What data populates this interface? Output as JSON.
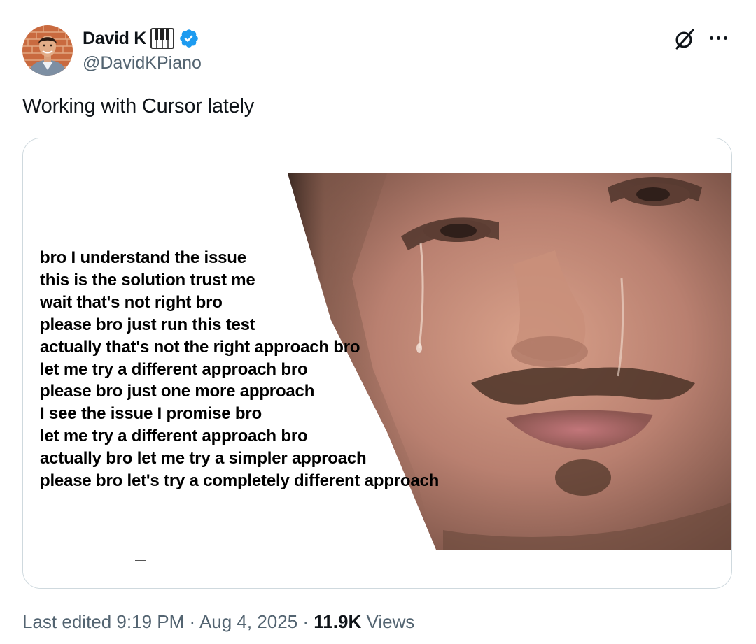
{
  "author": {
    "display_name": "David K",
    "emoji_icon": "piano-keys-icon",
    "verified_icon": "verified-badge-icon",
    "handle": "@DavidKPiano",
    "avatar_icon": "avatar"
  },
  "actions": {
    "grok_icon": "grok-icon",
    "more_icon": "more-icon"
  },
  "tweet": {
    "text": "Working with Cursor lately"
  },
  "meme": {
    "lines": [
      "bro I understand the issue",
      "this is the solution trust me",
      "wait that's not right bro",
      "please bro just run this test",
      "actually that's not the right approach bro",
      "let me try a different approach bro",
      "please bro just one more approach",
      "I see the issue I promise bro",
      "let me try a different approach bro",
      "actually bro let me try a simpler approach",
      "please bro let's try a completely different approach"
    ]
  },
  "footer": {
    "edited": "Last edited 9:19 PM",
    "sep1": " · ",
    "date": "Aug 4, 2025",
    "sep2": " · ",
    "views_count": "11.9K",
    "views_label": " Views"
  },
  "colors": {
    "verified": "#1d9bf0",
    "secondary_text": "#536471",
    "border": "#cfd9de"
  }
}
